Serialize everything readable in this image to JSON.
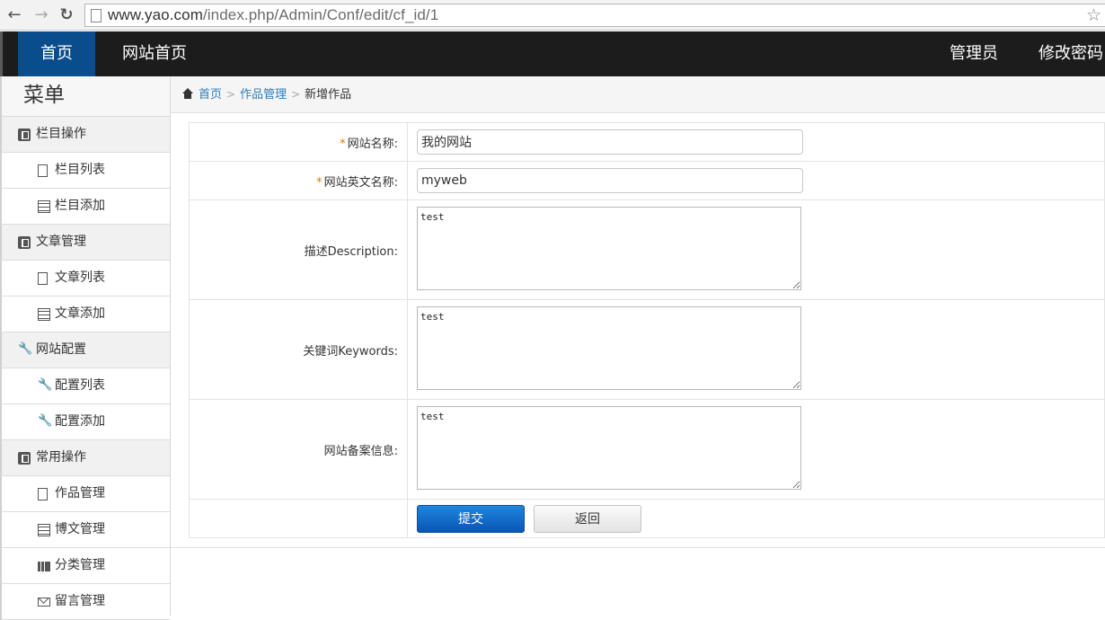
{
  "browser": {
    "url_host": "www.yao.com",
    "url_path": "/index.php/Admin/Conf/edit/cf_id/1"
  },
  "topnav": {
    "home": "首页",
    "site_home": "网站首页",
    "admin": "管理员",
    "change_password": "修改密码"
  },
  "sidebar": {
    "title": "菜单",
    "groups": [
      {
        "label": "栏目操作",
        "items": [
          "栏目列表",
          "栏目添加"
        ]
      },
      {
        "label": "文章管理",
        "items": [
          "文章列表",
          "文章添加"
        ]
      },
      {
        "label": "网站配置",
        "items": [
          "配置列表",
          "配置添加"
        ]
      },
      {
        "label": "常用操作",
        "items": [
          "作品管理",
          "博文管理",
          "分类管理",
          "留言管理"
        ]
      }
    ]
  },
  "breadcrumb": {
    "home": "首页",
    "section": "作品管理",
    "current": "新增作品"
  },
  "form": {
    "required_mark": "*",
    "site_name_label": "网站名称:",
    "site_name_value": "我的网站",
    "site_en_name_label": "网站英文名称:",
    "site_en_name_value": "myweb",
    "description_label": "描述Description:",
    "description_value": "test",
    "keywords_label": "关键词Keywords:",
    "keywords_value": "test",
    "icp_label": "网站备案信息:",
    "icp_value": "test",
    "submit_label": "提交",
    "back_label": "返回"
  }
}
